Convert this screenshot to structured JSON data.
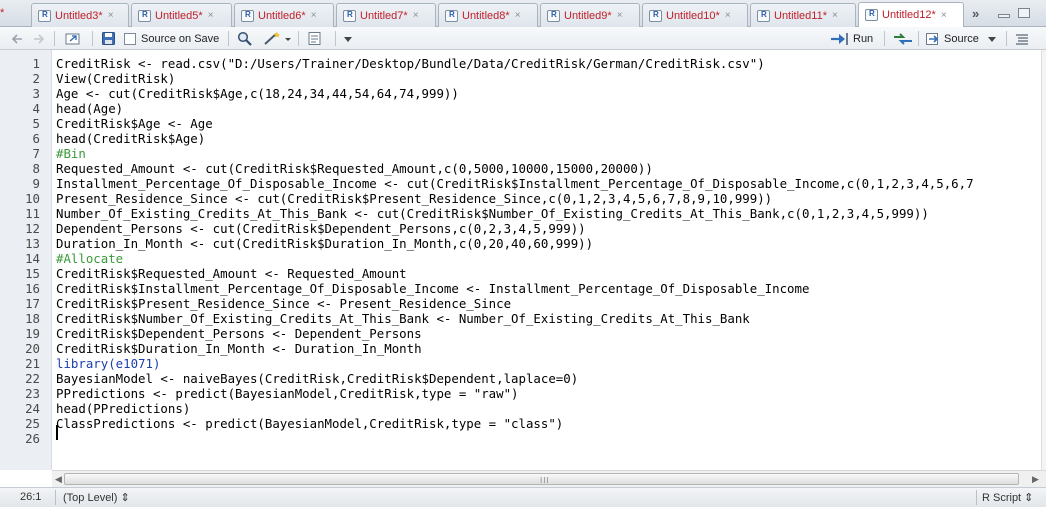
{
  "tabs": [
    {
      "label": "*",
      "close": ""
    },
    {
      "label": "Untitled3*",
      "close": "×"
    },
    {
      "label": "Untitled5*",
      "close": "×"
    },
    {
      "label": "Untitled6*",
      "close": "×"
    },
    {
      "label": "Untitled7*",
      "close": "×"
    },
    {
      "label": "Untitled8*",
      "close": "×"
    },
    {
      "label": "Untitled9*",
      "close": "×"
    },
    {
      "label": "Untitled10*",
      "close": "×"
    },
    {
      "label": "Untitled11*",
      "close": "×"
    },
    {
      "label": "Untitled12*",
      "close": "×"
    }
  ],
  "overflow": "»",
  "toolbar": {
    "source_on_save": "Source on Save",
    "run": "Run",
    "source": "Source"
  },
  "editor": {
    "lines": [
      {
        "n": "1",
        "text": "CreditRisk <- read.csv(\"D:/Users/Trainer/Desktop/Bundle/Data/CreditRisk/German/CreditRisk.csv\")",
        "kind": "code"
      },
      {
        "n": "2",
        "text": "View(CreditRisk)",
        "kind": "code"
      },
      {
        "n": "3",
        "text": "Age <- cut(CreditRisk$Age,c(18,24,34,44,54,64,74,999))",
        "kind": "code"
      },
      {
        "n": "4",
        "text": "head(Age)",
        "kind": "code"
      },
      {
        "n": "5",
        "text": "CreditRisk$Age <- Age",
        "kind": "code"
      },
      {
        "n": "6",
        "text": "head(CreditRisk$Age)",
        "kind": "code"
      },
      {
        "n": "7",
        "text": "#Bin",
        "kind": "comment"
      },
      {
        "n": "8",
        "text": "Requested_Amount <- cut(CreditRisk$Requested_Amount,c(0,5000,10000,15000,20000))",
        "kind": "code"
      },
      {
        "n": "9",
        "text": "Installment_Percentage_Of_Disposable_Income <- cut(CreditRisk$Installment_Percentage_Of_Disposable_Income,c(0,1,2,3,4,5,6,7",
        "kind": "code"
      },
      {
        "n": "10",
        "text": "Present_Residence_Since <- cut(CreditRisk$Present_Residence_Since,c(0,1,2,3,4,5,6,7,8,9,10,999))",
        "kind": "code"
      },
      {
        "n": "11",
        "text": "Number_Of_Existing_Credits_At_This_Bank <- cut(CreditRisk$Number_Of_Existing_Credits_At_This_Bank,c(0,1,2,3,4,5,999))",
        "kind": "code"
      },
      {
        "n": "12",
        "text": "Dependent_Persons <- cut(CreditRisk$Dependent_Persons,c(0,2,3,4,5,999))",
        "kind": "code"
      },
      {
        "n": "13",
        "text": "Duration_In_Month <- cut(CreditRisk$Duration_In_Month,c(0,20,40,60,999))",
        "kind": "code"
      },
      {
        "n": "14",
        "text": "#Allocate",
        "kind": "comment"
      },
      {
        "n": "15",
        "text": "CreditRisk$Requested_Amount <- Requested_Amount",
        "kind": "code"
      },
      {
        "n": "16",
        "text": "CreditRisk$Installment_Percentage_Of_Disposable_Income <- Installment_Percentage_Of_Disposable_Income",
        "kind": "code"
      },
      {
        "n": "17",
        "text": "CreditRisk$Present_Residence_Since <- Present_Residence_Since",
        "kind": "code"
      },
      {
        "n": "18",
        "text": "CreditRisk$Number_Of_Existing_Credits_At_This_Bank <- Number_Of_Existing_Credits_At_This_Bank",
        "kind": "code"
      },
      {
        "n": "19",
        "text": "CreditRisk$Dependent_Persons <- Dependent_Persons",
        "kind": "code"
      },
      {
        "n": "20",
        "text": "CreditRisk$Duration_In_Month <- Duration_In_Month",
        "kind": "code"
      },
      {
        "n": "21",
        "text": "library(e1071)",
        "kind": "func"
      },
      {
        "n": "22",
        "text": "BayesianModel <- naiveBayes(CreditRisk,CreditRisk$Dependent,laplace=0)",
        "kind": "code"
      },
      {
        "n": "23",
        "text": "PPredictions <- predict(BayesianModel,CreditRisk,type = \"raw\")",
        "kind": "code"
      },
      {
        "n": "24",
        "text": "head(PPredictions)",
        "kind": "code"
      },
      {
        "n": "25",
        "text": "ClassPredictions <- predict(BayesianModel,CreditRisk,type = \"class\")",
        "kind": "code"
      },
      {
        "n": "26",
        "text": "",
        "kind": "code"
      }
    ]
  },
  "scrollbar": {
    "left_arrow": "◀",
    "right_arrow": "▶",
    "grip": "III"
  },
  "status": {
    "position": "26:1",
    "scope": "(Top Level) ⇕",
    "file_type": "R Script ⇕"
  },
  "colors": {
    "tab_text": "#c0202a",
    "comment": "#3a9a3a",
    "function": "#1c3fb0",
    "gutter": "#ebeef2"
  }
}
